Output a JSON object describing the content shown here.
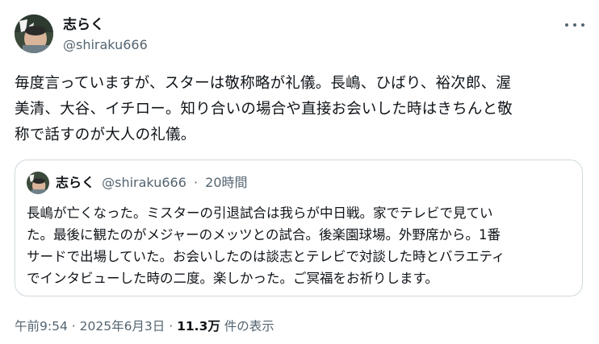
{
  "author": {
    "name": "志らく",
    "handle": "@shiraku666"
  },
  "tweet": {
    "text": "毎度言っていますが、スターは敬称略が礼儀。長嶋、ひばり、裕次郎、渥\n美清、大谷、イチロー。知り合いの場合や直接お会いした時はきちんと敬\n称で話すのが大人の礼儀。"
  },
  "quoted": {
    "name": "志らく",
    "handle": "@shiraku666",
    "separator": "·",
    "time": "20時間",
    "text": "長嶋が亡くなった。ミスターの引退試合は我らが中日戦。家でテレビで見てい\nた。最後に観たのがメジャーのメッツとの試合。後楽園球場。外野席から。1番\nサードで出場していた。お会いしたのは談志とテレビで対談した時とバラエティ\nでインタビューした時の二度。楽しかった。ご冥福をお祈りします。"
  },
  "footer": {
    "time": "午前9:54",
    "sep1": "·",
    "date": "2025年6月3日",
    "sep2": "·",
    "views": "11.3万",
    "views_label": "件の表示"
  },
  "icons": {
    "more": "more-horizontal-icon"
  }
}
